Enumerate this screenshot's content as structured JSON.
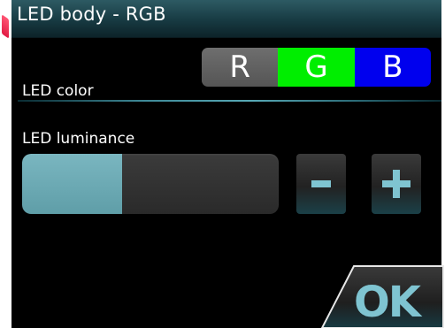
{
  "window": {
    "title": "LED body - RGB"
  },
  "led_color": {
    "label": "LED color",
    "options": [
      {
        "label": "R",
        "color": "#5f5f5f",
        "selected": false
      },
      {
        "label": "G",
        "color": "#00ee00",
        "selected": true
      },
      {
        "label": "B",
        "color": "#0000ee",
        "selected": false
      }
    ]
  },
  "led_luminance": {
    "label": "LED luminance",
    "level_fraction": 0.39,
    "minus_icon": "minus-icon",
    "plus_icon": "plus-icon"
  },
  "actions": {
    "ok_label": "OK"
  },
  "colors": {
    "accent": "#7fc4d1",
    "title_bar": "#173a42",
    "slider_fill": "#6aa9b3",
    "background": "#000000"
  }
}
